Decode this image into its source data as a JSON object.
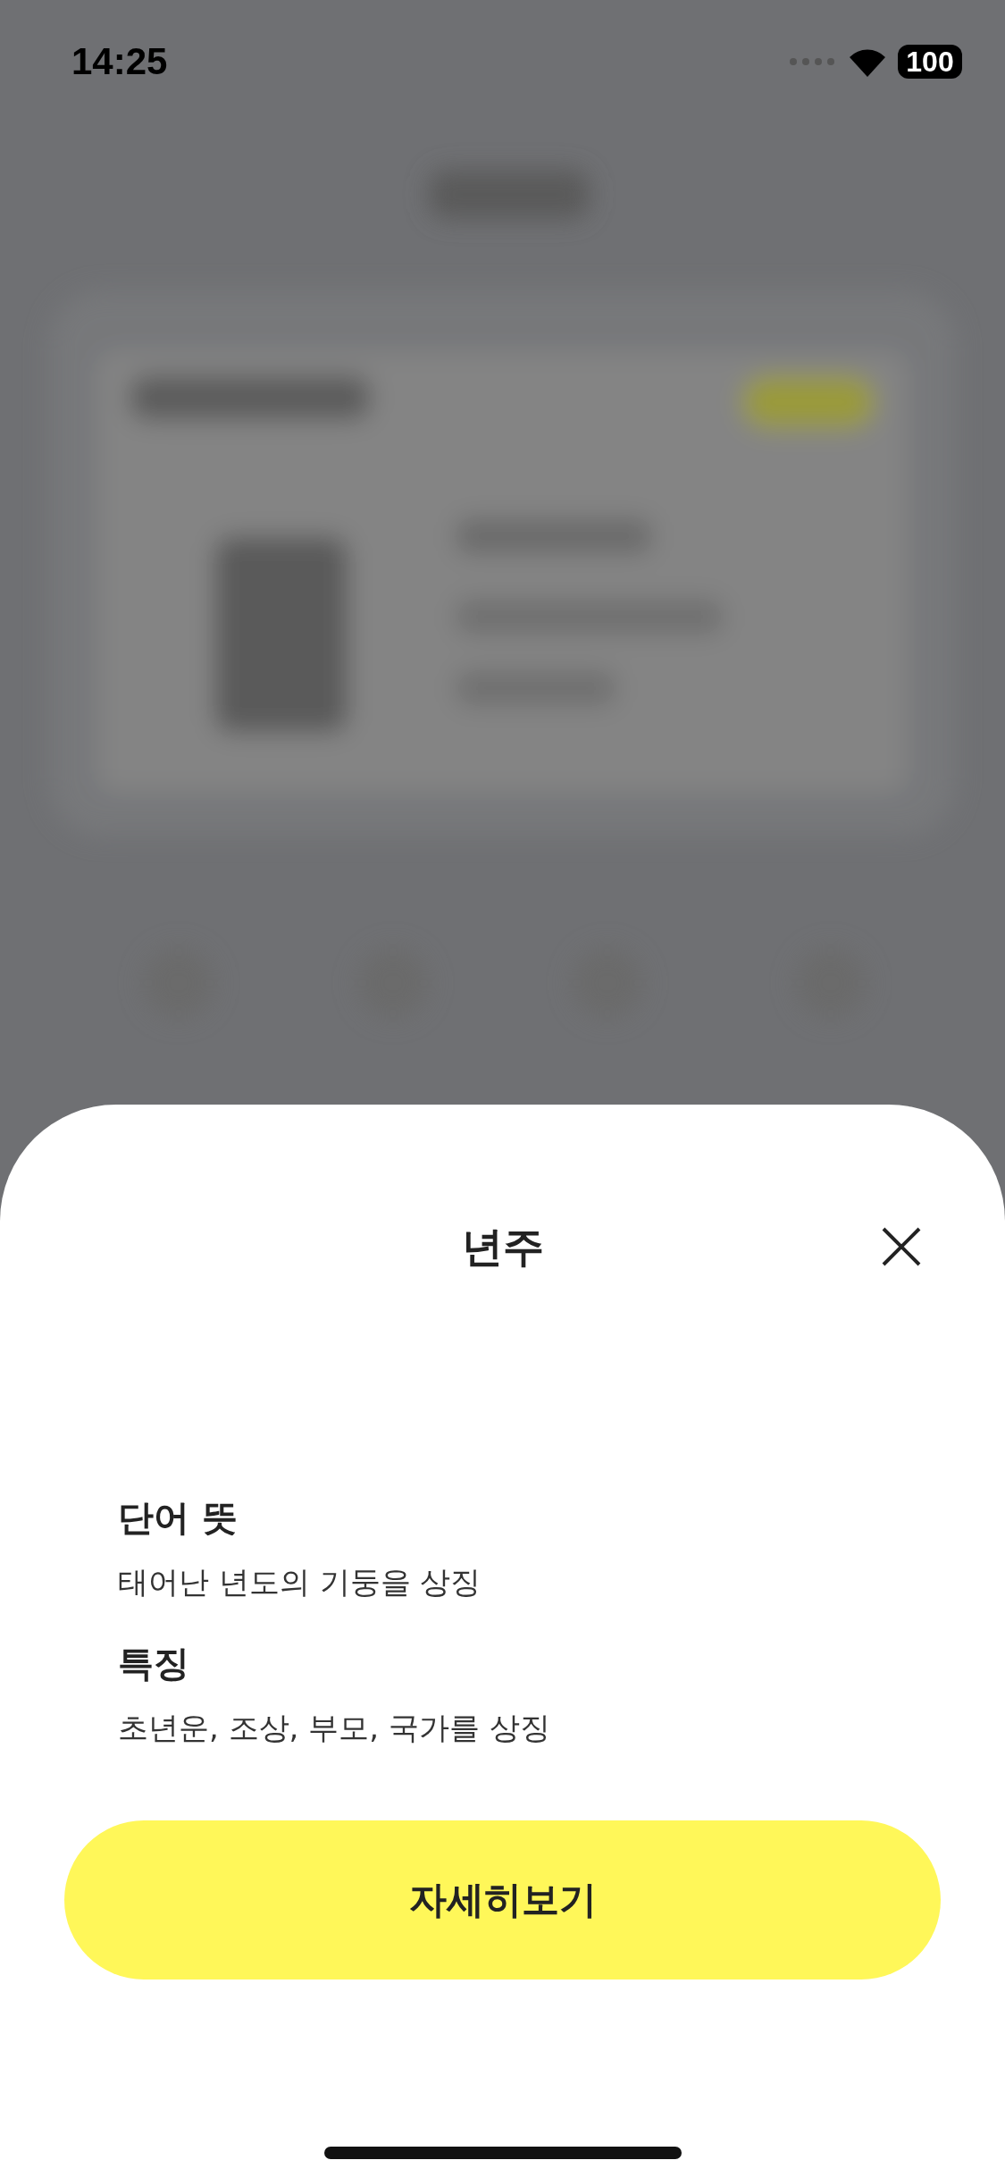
{
  "status_bar": {
    "time": "14:25",
    "battery": "100"
  },
  "sheet": {
    "title": "년주",
    "sections": [
      {
        "heading": "단어 뜻",
        "text": "태어난 년도의 기둥을 상징"
      },
      {
        "heading": "특징",
        "text": "초년운, 조상, 부모, 국가를 상징"
      }
    ],
    "button": "자세히보기"
  }
}
